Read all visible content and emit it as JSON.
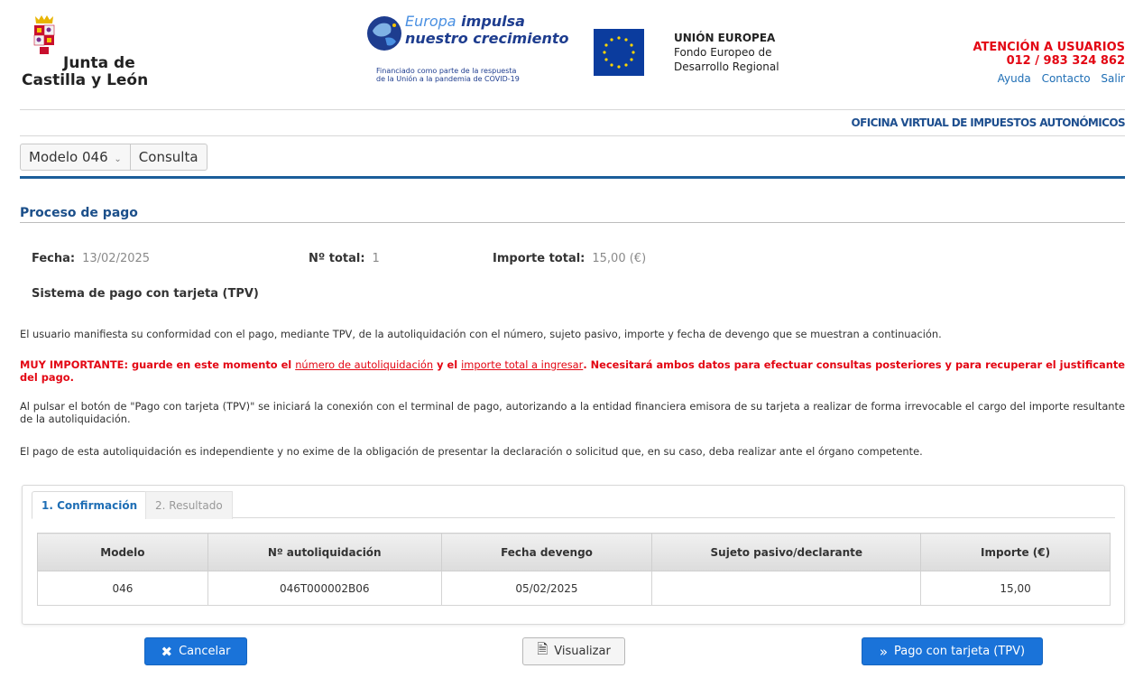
{
  "header": {
    "jcyl_logo": {
      "line1": "Junta de",
      "line2": "Castilla y León"
    },
    "europa": {
      "word1": "Europa",
      "word2": "impulsa",
      "line2": "nuestro crecimiento",
      "funded_line1": "Financiado como parte de la respuesta",
      "funded_line2": "de la Unión a la pandemia de COVID-19"
    },
    "ue": {
      "title": "UNIÓN EUROPEA",
      "line2": "Fondo Europeo de",
      "line3": "Desarrollo Regional"
    },
    "attention": {
      "line1": "ATENCIÓN A USUARIOS",
      "line2": "012 / 983 324 862"
    },
    "links": {
      "ayuda": "Ayuda",
      "contacto": "Contacto",
      "salir": "Salir"
    },
    "office": "OFICINA VIRTUAL DE IMPUESTOS AUTONÓMICOS"
  },
  "menu": {
    "modelo": "Modelo 046",
    "consulta": "Consulta"
  },
  "section_title": "Proceso de pago",
  "info": {
    "fecha_label": "Fecha:",
    "fecha_value": "13/02/2025",
    "total_label": "Nº total:",
    "total_value": "1",
    "importe_label": "Importe total:",
    "importe_value": "15,00 (€)"
  },
  "tpv_title": "Sistema de pago con tarjeta (TPV)",
  "paragraphs": {
    "p1": "El usuario manifiesta su conformidad con el pago, mediante TPV, de la autoliquidación con el número, sujeto pasivo, importe y fecha de devengo que se muestran a continuación.",
    "p2_a": "MUY IMPORTANTE: guarde en este momento el ",
    "p2_u1": "número de autoliquidación",
    "p2_b": " y el ",
    "p2_u2": "importe total a ingresar",
    "p2_c": ". Necesitará ambos datos para efectuar consultas posteriores y para recuperar el justificante del pago.",
    "p3": "Al pulsar el botón de \"Pago con tarjeta (TPV)\" se iniciará la conexión con el terminal de pago, autorizando a la entidad financiera emisora de su tarjeta a realizar de forma irrevocable el cargo del importe resultante de la autoliquidación.",
    "p4": "El pago de esta autoliquidación es independiente y no exime de la obligación de presentar la declaración o solicitud que, en su caso, deba realizar ante el órgano competente."
  },
  "tabs": {
    "tab1": "1. Confirmación",
    "tab2": "2. Resultado"
  },
  "table": {
    "headers": [
      "Modelo",
      "Nº autoliquidación",
      "Fecha devengo",
      "Sujeto pasivo/declarante",
      "Importe (€)"
    ],
    "rows": [
      [
        "046",
        "046T000002B06",
        "05/02/2025",
        "",
        "15,00"
      ]
    ]
  },
  "buttons": {
    "cancel": "Cancelar",
    "view": "Visualizar",
    "pay": "Pago con tarjeta (TPV)"
  },
  "colors": {
    "brand_blue": "#1b5e9a",
    "button_blue": "#1a73d9",
    "alert_red": "#e30613",
    "link_blue": "#1e6eb5"
  }
}
